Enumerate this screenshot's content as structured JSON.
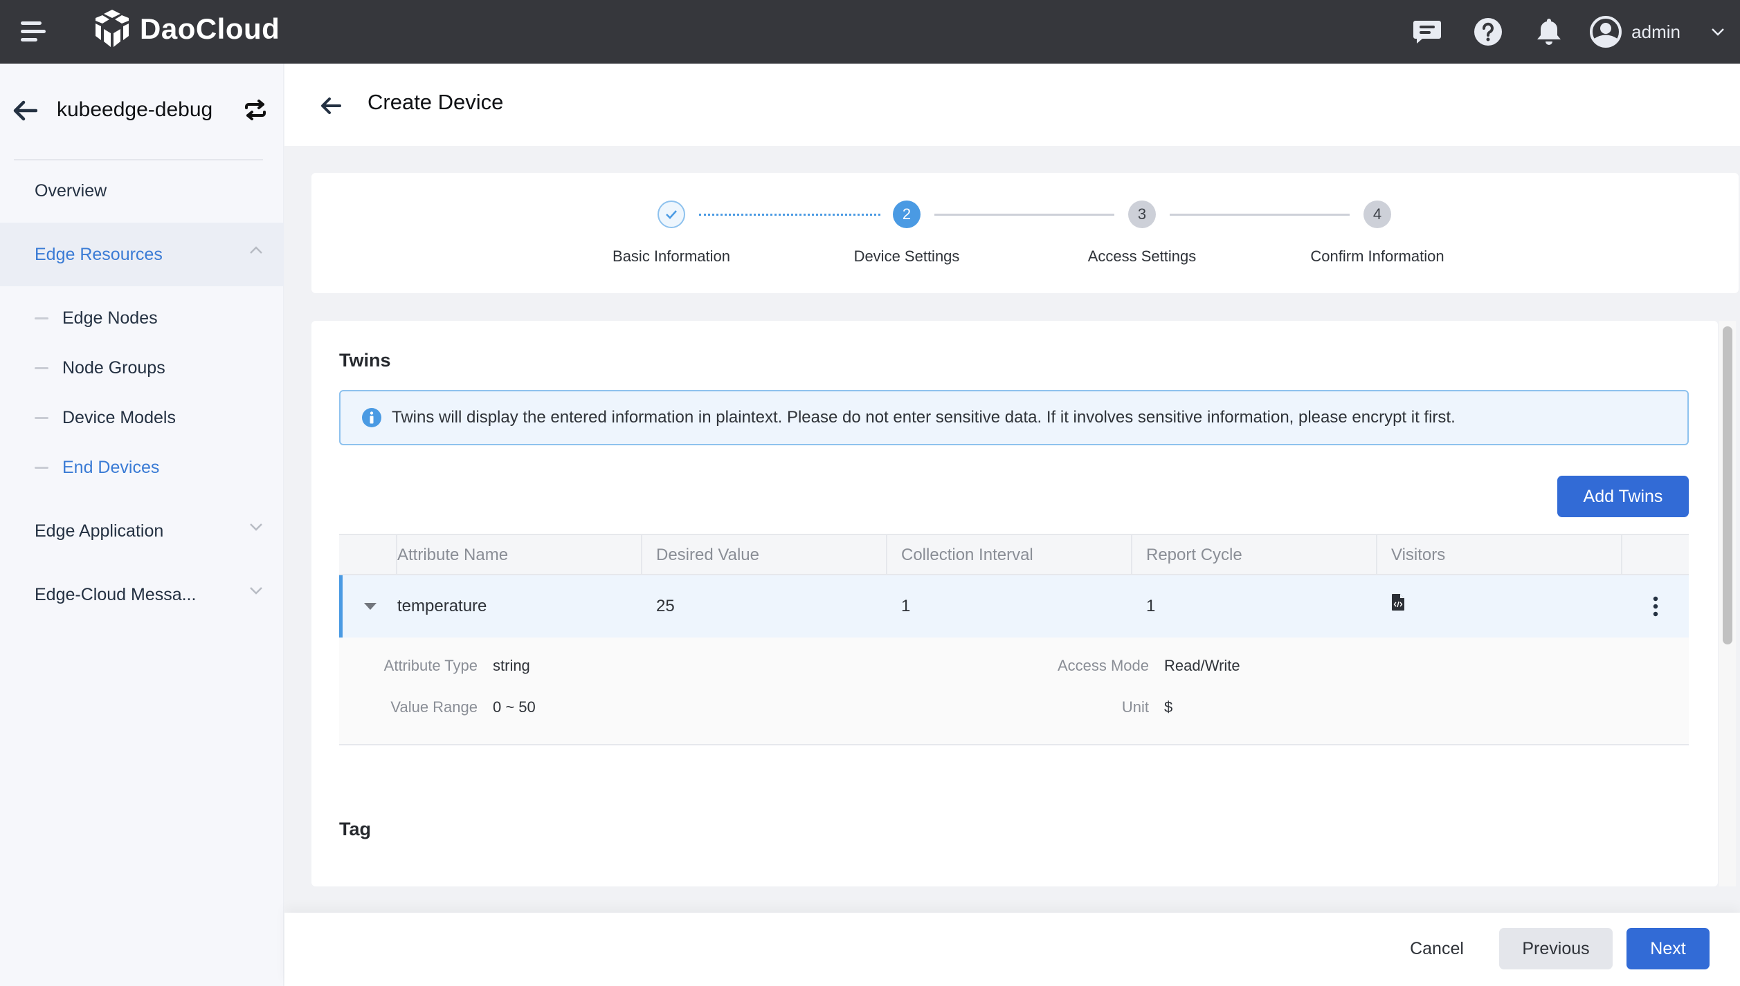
{
  "topbar": {
    "brand": "DaoCloud",
    "icons": [
      "menu-icon",
      "message-icon",
      "help-icon",
      "bell-icon",
      "user-avatar-icon",
      "chevron-down-icon"
    ],
    "user_name": "admin"
  },
  "sidebar": {
    "workspace": "kubeedge-debug",
    "items": [
      {
        "label": "Overview"
      },
      {
        "label": "Edge Resources",
        "expanded": true,
        "active": true
      },
      {
        "label": "Edge Application",
        "expanded": false
      },
      {
        "label": "Edge-Cloud Messa...",
        "expanded": false
      }
    ],
    "sub_items": [
      {
        "label": "Edge Nodes"
      },
      {
        "label": "Node Groups"
      },
      {
        "label": "Device Models"
      },
      {
        "label": "End Devices",
        "active": true
      }
    ]
  },
  "page": {
    "title": "Create Device"
  },
  "steps": [
    {
      "index": "1",
      "label": "Basic Information",
      "state": "done"
    },
    {
      "index": "2",
      "label": "Device Settings",
      "state": "current"
    },
    {
      "index": "3",
      "label": "Access Settings",
      "state": "todo"
    },
    {
      "index": "4",
      "label": "Confirm Information",
      "state": "todo"
    }
  ],
  "twins": {
    "title": "Twins",
    "alert": "Twins will display the entered information in plaintext. Please do not enter sensitive data. If it involves sensitive information, please encrypt it first.",
    "add_button": "Add Twins",
    "columns": [
      "Attribute Name",
      "Desired Value",
      "Collection Interval",
      "Report Cycle",
      "Visitors",
      ""
    ],
    "rows": [
      {
        "name": "temperature",
        "desired_value": "25",
        "collection_interval": "1",
        "report_cycle": "1",
        "visitors_icon": "code-file-icon",
        "details": {
          "attribute_type_label": "Attribute Type",
          "attribute_type": "string",
          "value_range_label": "Value Range",
          "value_range": "0 ~ 50",
          "access_mode_label": "Access Mode",
          "access_mode": "Read/Write",
          "unit_label": "Unit",
          "unit": "$"
        }
      }
    ]
  },
  "tag": {
    "title": "Tag"
  },
  "footer": {
    "cancel": "Cancel",
    "previous": "Previous",
    "next": "Next"
  },
  "colors": {
    "primary": "#326bd6",
    "accent": "#4a9ae3",
    "topbar": "#36373c",
    "active_nav": "#3a7bd5"
  }
}
